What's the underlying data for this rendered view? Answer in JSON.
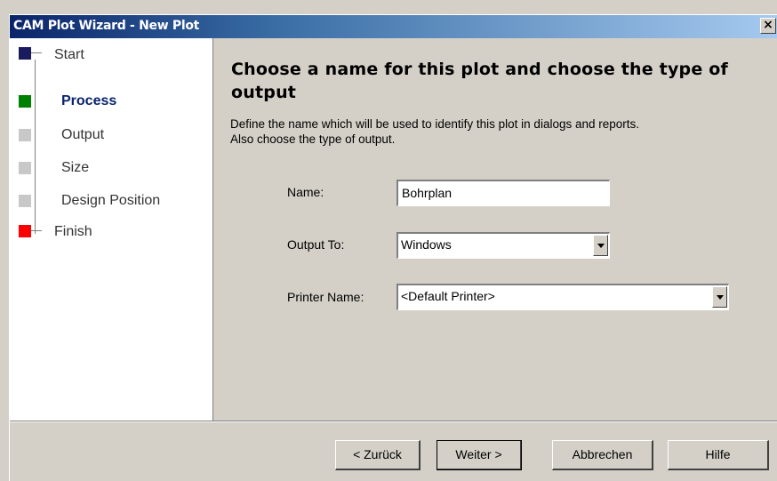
{
  "window": {
    "title": "CAM Plot  Wizard - New Plot",
    "close_glyph": "×"
  },
  "sidebar": {
    "steps": [
      {
        "label": "Start",
        "color": "#1a1a5e"
      },
      {
        "label": "Process",
        "color": "#008000",
        "active": true
      },
      {
        "label": "Output",
        "color": "#c8c8c8"
      },
      {
        "label": "Size",
        "color": "#c8c8c8"
      },
      {
        "label": "Design Position",
        "color": "#c8c8c8"
      },
      {
        "label": "Finish",
        "color": "#ff0000"
      }
    ]
  },
  "main": {
    "heading": "Choose a name for this plot and choose the type of output",
    "description_line1": "Define the name which will be used to identify this plot in dialogs and reports.",
    "description_line2": "Also choose the type of output.",
    "name_label": "Name:",
    "name_value": "Bohrplan",
    "output_label": "Output To:",
    "output_value": "Windows",
    "printer_label": "Printer Name:",
    "printer_value": "<Default Printer>"
  },
  "footer": {
    "back_label": "< Zurück",
    "next_label": "Weiter >",
    "cancel_label": "Abbrechen",
    "help_label": "Hilfe"
  }
}
